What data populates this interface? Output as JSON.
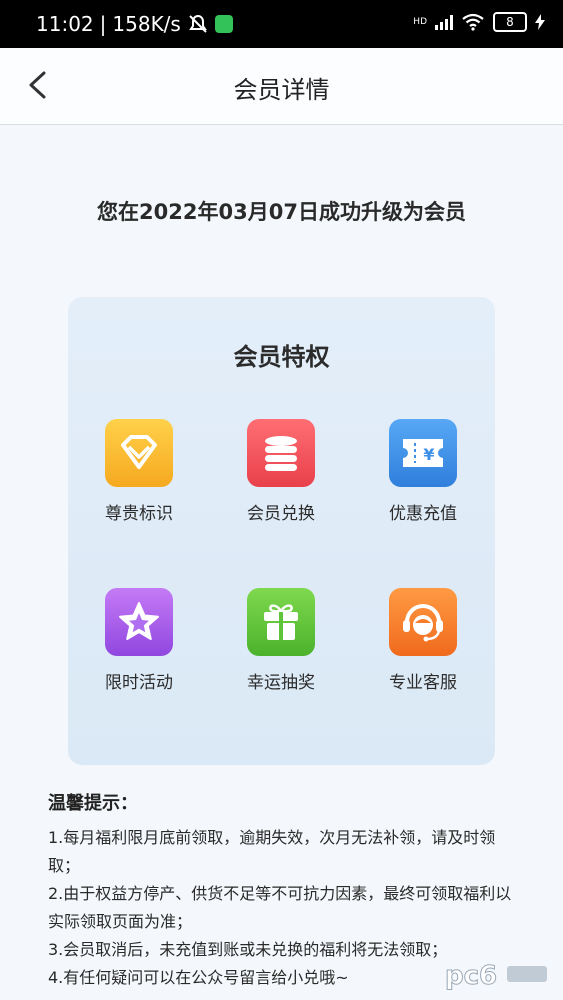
{
  "status_bar": {
    "time": "11:02",
    "speed": "158K/s",
    "battery": "8",
    "network": "HD"
  },
  "header": {
    "title": "会员详情"
  },
  "upgrade_message": "您在2022年03月07日成功升级为会员",
  "privileges": {
    "title": "会员特权",
    "items": [
      {
        "label": "尊贵标识",
        "icon": "diamond-icon",
        "color": "#f5b82e"
      },
      {
        "label": "会员兑换",
        "icon": "coin-stack-icon",
        "color": "#f0525a"
      },
      {
        "label": "优惠充值",
        "icon": "yuan-ticket-icon",
        "color": "#3d8fe8"
      },
      {
        "label": "限时活动",
        "icon": "star-icon",
        "color": "#a356e6"
      },
      {
        "label": "幸运抽奖",
        "icon": "gift-icon",
        "color": "#5ec43a"
      },
      {
        "label": "专业客服",
        "icon": "headset-icon",
        "color": "#f57d2c"
      }
    ]
  },
  "tips": {
    "title": "温馨提示：",
    "lines": [
      "1.每月福利限月底前领取，逾期失效，次月无法补领，请及时领取；",
      "2.由于权益方停产、供货不足等不可抗力因素，最终可领取福利以实际领取页面为准；",
      "3.会员取消后，未充值到账或未兑换的福利将无法领取；",
      "4.有任何疑问可以在公众号留言给小兑哦~"
    ]
  },
  "watermark": {
    "text": "pc6"
  }
}
